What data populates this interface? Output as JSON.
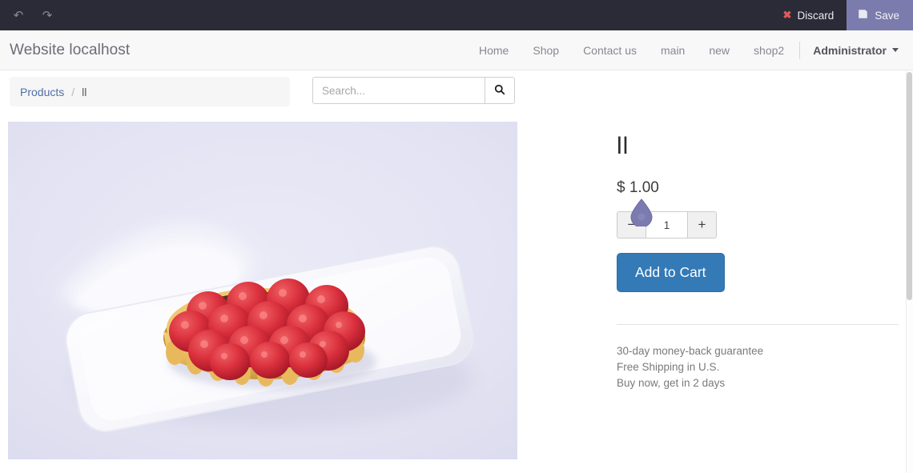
{
  "editor_bar": {
    "undo_icon": "undo-icon",
    "redo_icon": "redo-icon",
    "discard_label": "Discard",
    "save_label": "Save",
    "save_bg": "#7c7bad",
    "bar_bg": "#2b2b38",
    "discard_icon": "close-x-icon",
    "save_icon": "floppy-disk-icon"
  },
  "header": {
    "brand": "Website localhost",
    "nav": [
      {
        "label": "Home"
      },
      {
        "label": "Shop"
      },
      {
        "label": "Contact us"
      },
      {
        "label": "main"
      },
      {
        "label": "new"
      },
      {
        "label": "shop2"
      }
    ],
    "user_label": "Administrator"
  },
  "breadcrumb": {
    "root": "Products",
    "separator": "/",
    "current": "ll"
  },
  "search": {
    "placeholder": "Search...",
    "value": "",
    "button_icon": "search-icon"
  },
  "product": {
    "name": "ll",
    "price": "$ 1.00",
    "quantity": "1",
    "minus_label": "−",
    "plus_label": "+",
    "add_to_cart_label": "Add to Cart",
    "add_to_cart_color": "#337ab7",
    "image_alt": "raspberry-tart-on-white-plate",
    "image_bg": "#e3e3f3",
    "shipping_notes": [
      "30-day money-back guarantee",
      "Free Shipping in U.S.",
      "Buy now, get in 2 days"
    ]
  },
  "cursor": {
    "name": "mouse-pointer-teardrop",
    "color": "#7b7bb0"
  }
}
